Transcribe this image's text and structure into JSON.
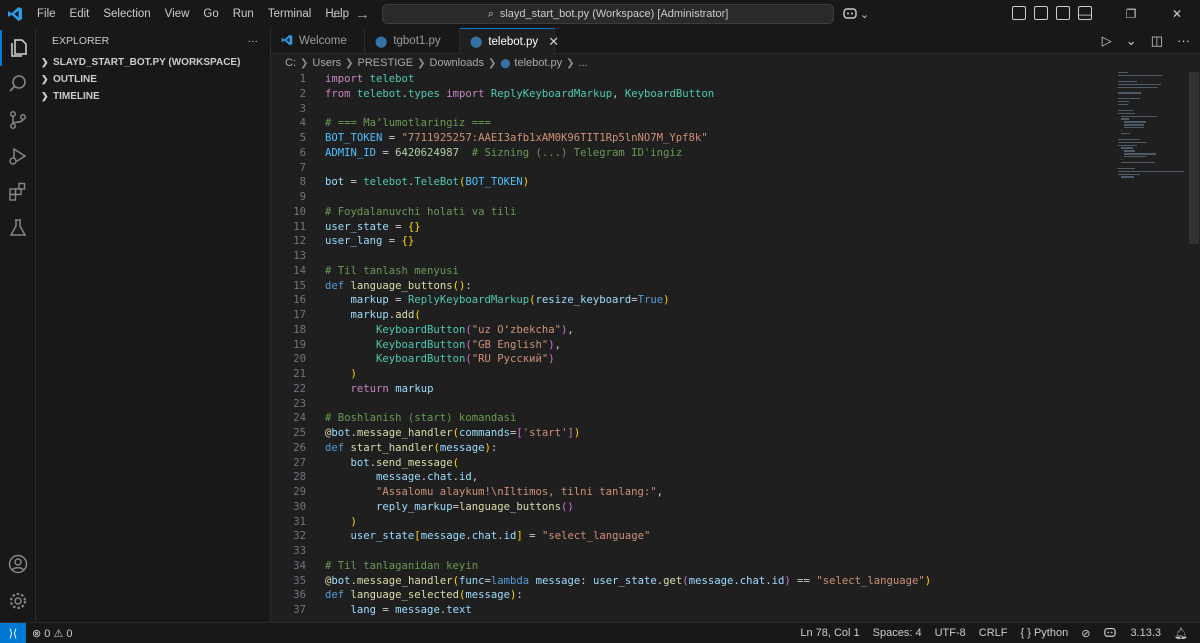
{
  "titlebar": {
    "menu": [
      "File",
      "Edit",
      "Selection",
      "View",
      "Go",
      "Run",
      "Terminal",
      "Help"
    ],
    "search_text": "slayd_start_bot.py (Workspace) [Administrator]"
  },
  "activity_bar": {
    "icons": [
      "explorer-icon",
      "search-icon",
      "source-control-icon",
      "run-debug-icon",
      "extensions-icon",
      "testing-icon",
      "account-icon",
      "manage-gear-icon"
    ]
  },
  "sidebar": {
    "title": "EXPLORER",
    "more": "···",
    "sections": [
      "SLAYD_START_BOT.PY (WORKSPACE)",
      "OUTLINE",
      "TIMELINE"
    ]
  },
  "tabs": [
    {
      "label": "Welcome",
      "icon": "vscode-icon",
      "active": false
    },
    {
      "label": "tgbot1.py",
      "icon": "python-file-icon",
      "active": false
    },
    {
      "label": "telebot.py",
      "icon": "python-file-icon",
      "active": true
    }
  ],
  "breadcrumb": [
    "C:",
    "Users",
    "PRESTIGE",
    "Downloads",
    "telebot.py",
    "..."
  ],
  "editor": {
    "lines": [
      {
        "n": "1",
        "html": "<span class=\"kw\">import</span> <span class=\"cls\">telebot</span>"
      },
      {
        "n": "2",
        "html": "<span class=\"kw\">from</span> <span class=\"cls\">telebot</span>.<span class=\"cls\">types</span> <span class=\"kw\">import</span> <span class=\"cls\">ReplyKeyboardMarkup</span>, <span class=\"cls\">KeyboardButton</span>"
      },
      {
        "n": "3",
        "html": ""
      },
      {
        "n": "4",
        "html": "<span class=\"cm\"># === Ma’lumotlaringiz ===</span>"
      },
      {
        "n": "5",
        "html": "<span class=\"const\">BOT_TOKEN</span> = <span class=\"str\">\"7711925257:AAEI3afb1xAM0K96TIT1Rp5lnNO7M_Ypf8k\"</span>"
      },
      {
        "n": "6",
        "html": "<span class=\"const\">ADMIN_ID</span> = <span class=\"num\">6420624987</span>  <span class=\"cm\"># Sizning (...) Telegram ID'ingiz</span>"
      },
      {
        "n": "7",
        "html": ""
      },
      {
        "n": "8",
        "html": "<span class=\"var\">bot</span> = <span class=\"cls\">telebot</span>.<span class=\"cls\">TeleBot</span><span class=\"br1\">(</span><span class=\"const\">BOT_TOKEN</span><span class=\"br1\">)</span>"
      },
      {
        "n": "9",
        "html": ""
      },
      {
        "n": "10",
        "html": "<span class=\"cm\"># Foydalanuvchi holati va tili</span>"
      },
      {
        "n": "11",
        "html": "<span class=\"var\">user_state</span> = <span class=\"br1\">{}</span>"
      },
      {
        "n": "12",
        "html": "<span class=\"var\">user_lang</span> = <span class=\"br1\">{}</span>"
      },
      {
        "n": "13",
        "html": ""
      },
      {
        "n": "14",
        "html": "<span class=\"cm\"># Til tanlash menyusi</span>"
      },
      {
        "n": "15",
        "html": "<span class=\"kwb\">def</span> <span class=\"fn\">language_buttons</span><span class=\"br1\">()</span>:"
      },
      {
        "n": "16",
        "html": "    <span class=\"var\">markup</span> = <span class=\"cls\">ReplyKeyboardMarkup</span><span class=\"br1\">(</span><span class=\"var\">resize_keyboard</span>=<span class=\"kwb\">True</span><span class=\"br1\">)</span>"
      },
      {
        "n": "17",
        "html": "    <span class=\"var\">markup</span>.<span class=\"fn\">add</span><span class=\"br1\">(</span>"
      },
      {
        "n": "18",
        "html": "        <span class=\"cls\">KeyboardButton</span><span class=\"br2\">(</span><span class=\"str\">\"uz O‘zbekcha\"</span><span class=\"br2\">)</span>,"
      },
      {
        "n": "19",
        "html": "        <span class=\"cls\">KeyboardButton</span><span class=\"br2\">(</span><span class=\"str\">\"GB English\"</span><span class=\"br2\">)</span>,"
      },
      {
        "n": "20",
        "html": "        <span class=\"cls\">KeyboardButton</span><span class=\"br2\">(</span><span class=\"str\">\"RU Русский\"</span><span class=\"br2\">)</span>"
      },
      {
        "n": "21",
        "html": "    <span class=\"br1\">)</span>"
      },
      {
        "n": "22",
        "html": "    <span class=\"kw\">return</span> <span class=\"var\">markup</span>"
      },
      {
        "n": "23",
        "html": ""
      },
      {
        "n": "24",
        "html": "<span class=\"cm\"># Boshlanish (start) komandasi</span>"
      },
      {
        "n": "25",
        "html": "<span class=\"dec\">@</span><span class=\"var\">bot</span>.<span class=\"fn\">message_handler</span><span class=\"br1\">(</span><span class=\"var\">commands</span>=<span class=\"br2\">[</span><span class=\"str\">'start'</span><span class=\"br2\">]</span><span class=\"br1\">)</span>"
      },
      {
        "n": "26",
        "html": "<span class=\"kwb\">def</span> <span class=\"fn\">start_handler</span><span class=\"br1\">(</span><span class=\"var\">message</span><span class=\"br1\">)</span>:"
      },
      {
        "n": "27",
        "html": "    <span class=\"var\">bot</span>.<span class=\"fn\">send_message</span><span class=\"br1\">(</span>"
      },
      {
        "n": "28",
        "html": "        <span class=\"var\">message</span>.<span class=\"var\">chat</span>.<span class=\"var\">id</span>,"
      },
      {
        "n": "29",
        "html": "        <span class=\"str\">\"Assalomu alaykum!\\nIltimos, tilni tanlang:\"</span>,"
      },
      {
        "n": "30",
        "html": "        <span class=\"var\">reply_markup</span>=<span class=\"fn\">language_buttons</span><span class=\"br2\">()</span>"
      },
      {
        "n": "31",
        "html": "    <span class=\"br1\">)</span>"
      },
      {
        "n": "32",
        "html": "    <span class=\"var\">user_state</span><span class=\"br1\">[</span><span class=\"var\">message</span>.<span class=\"var\">chat</span>.<span class=\"var\">id</span><span class=\"br1\">]</span> = <span class=\"str\">\"select_language\"</span>"
      },
      {
        "n": "33",
        "html": ""
      },
      {
        "n": "34",
        "html": "<span class=\"cm\"># Til tanlaganidan keyin</span>"
      },
      {
        "n": "35",
        "html": "<span class=\"dec\">@</span><span class=\"var\">bot</span>.<span class=\"fn\">message_handler</span><span class=\"br1\">(</span><span class=\"var\">func</span>=<span class=\"kwb\">lambda</span> <span class=\"var\">message</span>: <span class=\"var\">user_state</span>.<span class=\"fn\">get</span><span class=\"br2\">(</span><span class=\"var\">message</span>.<span class=\"var\">chat</span>.<span class=\"var\">id</span><span class=\"br2\">)</span> == <span class=\"str\">\"select_language\"</span><span class=\"br1\">)</span>"
      },
      {
        "n": "36",
        "html": "<span class=\"kwb\">def</span> <span class=\"fn\">language_selected</span><span class=\"br1\">(</span><span class=\"var\">message</span><span class=\"br1\">)</span>:"
      },
      {
        "n": "37",
        "html": "    <span class=\"var\">lang</span> = <span class=\"var\">message</span>.<span class=\"var\">text</span>"
      }
    ]
  },
  "statusbar": {
    "problems": "⊗ 0 ⚠ 0",
    "position": "Ln 78, Col 1",
    "spaces": "Spaces: 4",
    "encoding": "UTF-8",
    "eol": "CRLF",
    "language": "Python",
    "python_version": "3.13.3"
  },
  "colors": {
    "accent": "#0078d4",
    "background": "#1f1f1f",
    "chrome": "#181818"
  }
}
